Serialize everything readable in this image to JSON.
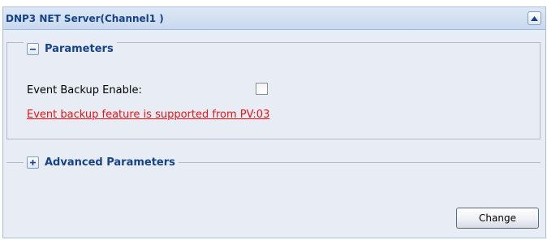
{
  "panel": {
    "title": "DNP3 NET Server(Channel1 )",
    "collapse_icon": "chevron-up-icon"
  },
  "parameters": {
    "legend": "Parameters",
    "toggle_icon": "minus-icon",
    "event_backup_label": "Event Backup Enable:",
    "event_backup_checked": false,
    "warning_text": "Event backup feature is supported from PV:03",
    "warning_color": "#ee1111"
  },
  "advanced": {
    "legend": "Advanced Parameters",
    "toggle_icon": "plus-icon"
  },
  "actions": {
    "change_label": "Change"
  },
  "colors": {
    "panel_bg": "#e8edf5",
    "title_text": "#15428b",
    "header_bg": "#c9d9ee"
  }
}
